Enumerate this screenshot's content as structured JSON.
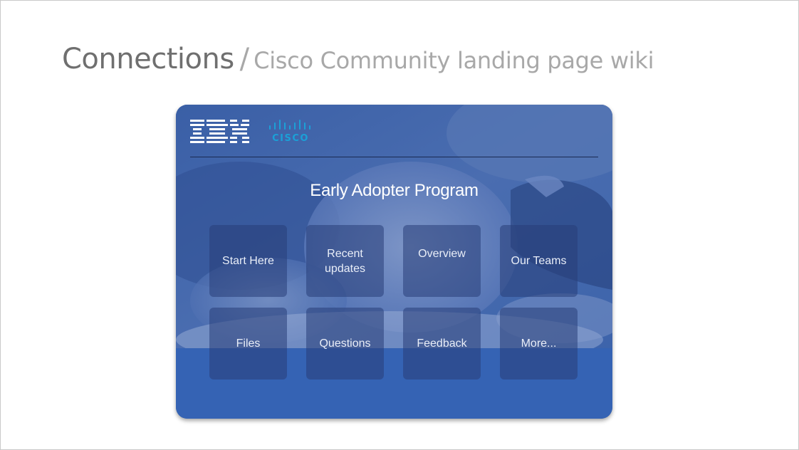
{
  "slide": {
    "title_main": "Connections",
    "title_separator": "/",
    "title_sub": "Cisco Community landing page wiki"
  },
  "card": {
    "logos": {
      "ibm": "IBM",
      "cisco": "CISCO"
    },
    "program_title": "Early Adopter Program",
    "tiles": [
      {
        "label": "Start Here"
      },
      {
        "label": "Recent updates"
      },
      {
        "label": "Overview"
      },
      {
        "label": "Our Teams"
      },
      {
        "label": "Files"
      },
      {
        "label": "Questions"
      },
      {
        "label": "Feedback"
      },
      {
        "label": "More..."
      }
    ]
  },
  "colors": {
    "card_blue": "#3d62a8",
    "band_blue": "#3563b4",
    "tile_overlay": "#283e78",
    "cisco_logo": "#1ba0d7",
    "title_gray": "#6f6f6f",
    "subtitle_gray": "#a8a8a8"
  }
}
